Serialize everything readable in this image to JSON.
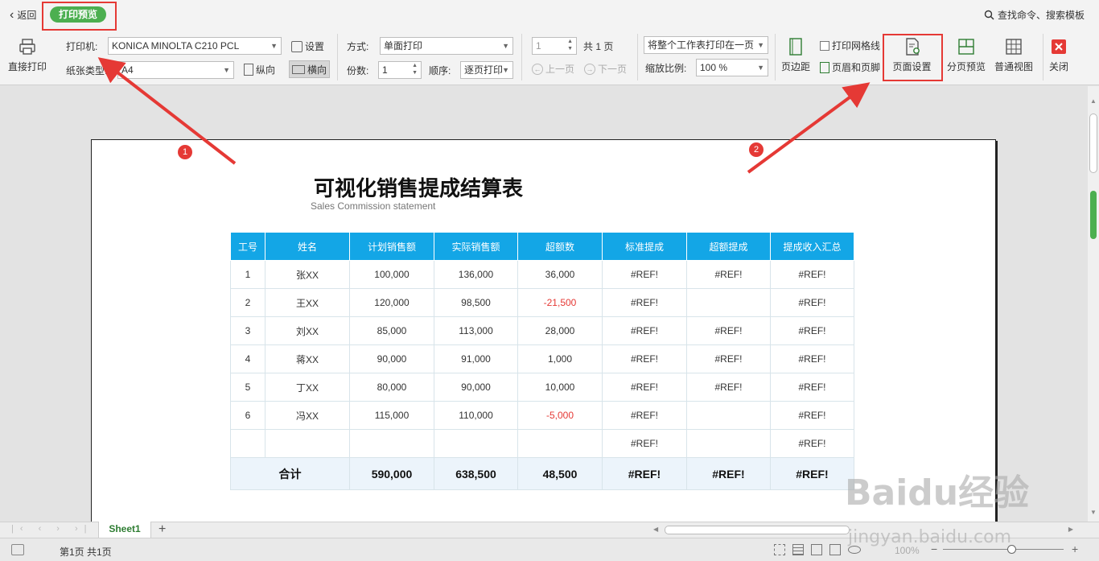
{
  "topbar": {
    "back_label": "返回",
    "mode_label": "打印预览",
    "search_label": "查找命令、搜索模板"
  },
  "ribbon": {
    "direct_print_label": "直接打印",
    "printer_label": "打印机:",
    "printer_value": "KONICA MINOLTA C210 PCL",
    "settings_label": "设置",
    "paper_type_label": "纸张类型:",
    "paper_type_value": "A4",
    "portrait_label": "纵向",
    "landscape_label": "横向",
    "mode_label": "方式:",
    "mode_value": "单面打印",
    "copies_label": "份数:",
    "copies_value": "1",
    "order_label": "顺序:",
    "order_value": "逐页打印",
    "page_value": "1",
    "total_pages": "共 1 页",
    "prev_label": "上一页",
    "next_label": "下一页",
    "fit_value": "将整个工作表打印在一页",
    "zoom_label": "缩放比例:",
    "zoom_value": "100 %",
    "margins_label": "页边距",
    "gridlines_label": "打印网格线",
    "header_footer_label": "页眉和页脚",
    "page_setup_label": "页面设置",
    "page_break_label": "分页预览",
    "normal_view_label": "普通视图",
    "close_label": "关闭"
  },
  "document": {
    "title": "可视化销售提成结算表",
    "subtitle": "Sales Commission statement",
    "headers": [
      "工号",
      "姓名",
      "计划销售额",
      "实际销售额",
      "超额数",
      "标准提成",
      "超额提成",
      "提成收入汇总"
    ],
    "rows": [
      [
        "1",
        "张XX",
        "100,000",
        "136,000",
        "36,000",
        "#REF!",
        "#REF!",
        "#REF!"
      ],
      [
        "2",
        "王XX",
        "120,000",
        "98,500",
        "-21,500",
        "#REF!",
        "",
        "#REF!"
      ],
      [
        "3",
        "刘XX",
        "85,000",
        "113,000",
        "28,000",
        "#REF!",
        "#REF!",
        "#REF!"
      ],
      [
        "4",
        "蒋XX",
        "90,000",
        "91,000",
        "1,000",
        "#REF!",
        "#REF!",
        "#REF!"
      ],
      [
        "5",
        "丁XX",
        "80,000",
        "90,000",
        "10,000",
        "#REF!",
        "#REF!",
        "#REF!"
      ],
      [
        "6",
        "冯XX",
        "115,000",
        "110,000",
        "-5,000",
        "#REF!",
        "",
        "#REF!"
      ],
      [
        "",
        "",
        "",
        "",
        "",
        "#REF!",
        "",
        "#REF!"
      ]
    ],
    "total": [
      "合计",
      "590,000",
      "638,500",
      "48,500",
      "#REF!",
      "#REF!",
      "#REF!"
    ]
  },
  "annotations": {
    "badge_1": "1",
    "badge_2": "2"
  },
  "tabs": {
    "sheet1": "Sheet1",
    "add": "+"
  },
  "status": {
    "page_info": "第1页 共1页",
    "zoom": "100%"
  },
  "watermark": {
    "brand": "Baidu经验",
    "url": "jingyan.baidu.com"
  },
  "colors": {
    "accent_green": "#4caf50",
    "header_blue": "#13a6e6",
    "annotation_red": "#e53935",
    "negative_red": "#e53935"
  }
}
